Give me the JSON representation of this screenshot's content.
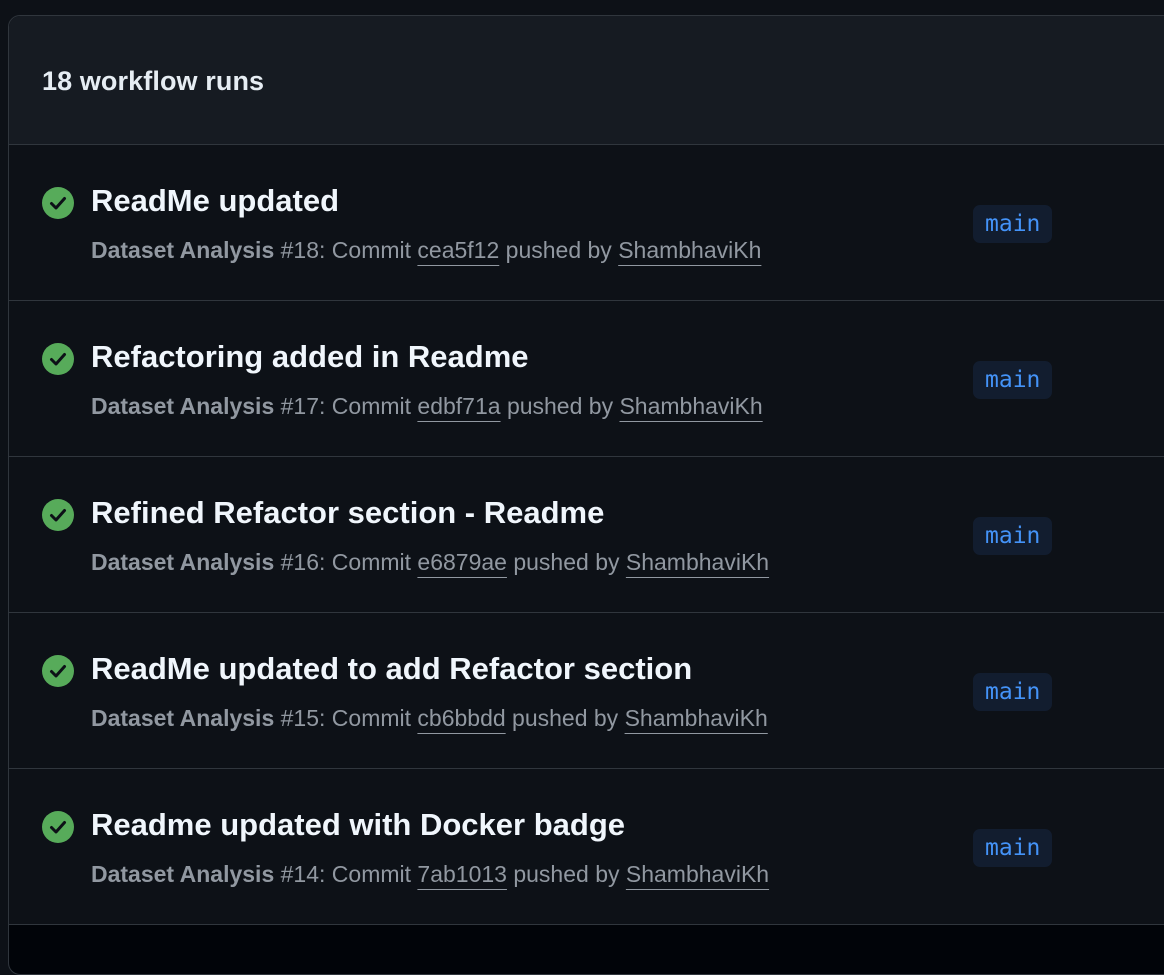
{
  "header": {
    "run_count": "18 workflow runs"
  },
  "runs": [
    {
      "status": "success",
      "status_icon": "check-circle-fill-icon",
      "title": "ReadMe updated",
      "workflow": "Dataset Analysis",
      "number": "#18",
      "commit_prefix": ": Commit",
      "commit": "cea5f12",
      "pushed_by": "pushed by",
      "author": "ShambhaviKh",
      "branch": "main"
    },
    {
      "status": "success",
      "status_icon": "check-circle-fill-icon",
      "title": "Refactoring added in Readme",
      "workflow": "Dataset Analysis",
      "number": "#17",
      "commit_prefix": ": Commit",
      "commit": "edbf71a",
      "pushed_by": "pushed by",
      "author": "ShambhaviKh",
      "branch": "main"
    },
    {
      "status": "success",
      "status_icon": "check-circle-fill-icon",
      "title": "Refined Refactor section - Readme",
      "workflow": "Dataset Analysis",
      "number": "#16",
      "commit_prefix": ": Commit",
      "commit": "e6879ae",
      "pushed_by": "pushed by",
      "author": "ShambhaviKh",
      "branch": "main"
    },
    {
      "status": "success",
      "status_icon": "check-circle-fill-icon",
      "title": "ReadMe updated to add Refactor section",
      "workflow": "Dataset Analysis",
      "number": "#15",
      "commit_prefix": ": Commit",
      "commit": "cb6bbdd",
      "pushed_by": "pushed by",
      "author": "ShambhaviKh",
      "branch": "main"
    },
    {
      "status": "success",
      "status_icon": "check-circle-fill-icon",
      "title": "Readme updated with Docker badge",
      "workflow": "Dataset Analysis",
      "number": "#14",
      "commit_prefix": ": Commit",
      "commit": "7ab1013",
      "pushed_by": "pushed by",
      "author": "ShambhaviKh",
      "branch": "main"
    }
  ],
  "colors": {
    "success": "#57ab5a",
    "branch_text": "#4493f8",
    "branch_bg": "#121d2f",
    "muted_text": "#9198a1",
    "border": "#30363d"
  }
}
